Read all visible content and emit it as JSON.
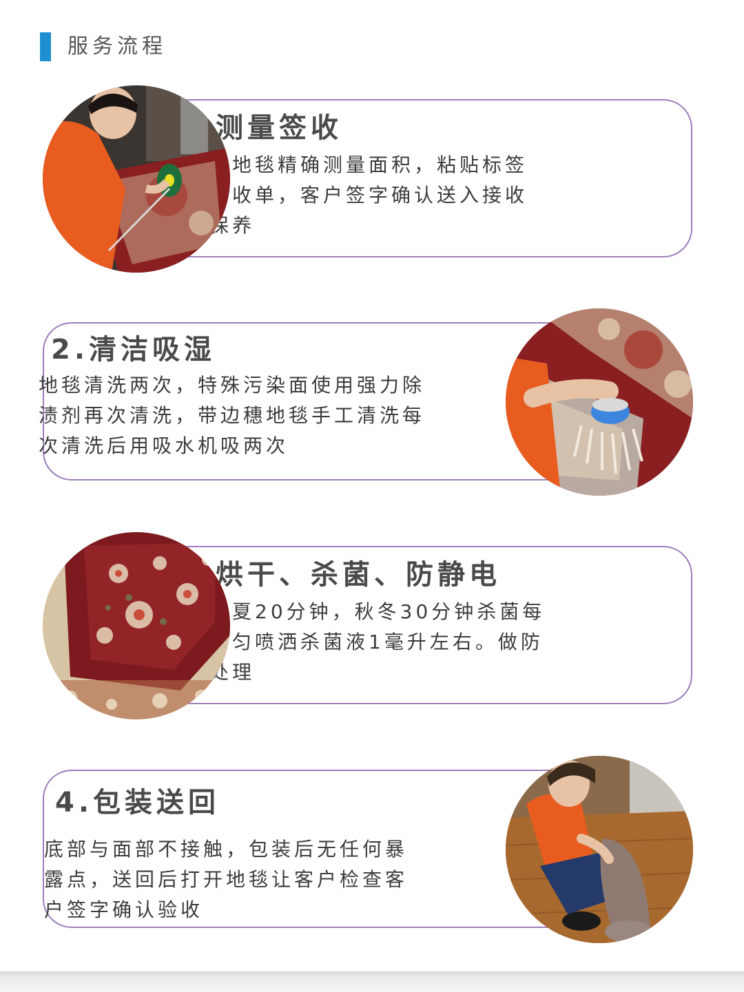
{
  "header": {
    "title": "服务流程",
    "accent_color": "#1e8fd0"
  },
  "card_border_color": "#9b7dbb",
  "steps": [
    {
      "title": "1.测量签收",
      "desc_lines": [
        "小面积地毯精确测量面积，粘贴标签",
        "开据接收单，客户签字确认送入接收",
        "间待保养"
      ],
      "photo_icon": "measuring-rug-photo"
    },
    {
      "title": "2.清洁吸湿",
      "desc_lines": [
        "地毯清洗两次，特殊污染面使用强力除",
        "渍剂再次清洗，带边穗地毯手工清洗每",
        "次清洗后用吸水机吸两次"
      ],
      "photo_icon": "brushing-fringe-photo"
    },
    {
      "title": "3.烘干、杀菌、防静电",
      "desc_lines": [
        "烘干春夏20分钟，秋冬30分钟杀菌每",
        "平米均匀喷洒杀菌液1毫升左右。做防",
        "静电处理"
      ],
      "photo_icon": "rug-pattern-photo"
    },
    {
      "title": "4.包装送回",
      "desc_lines": [
        "底部与面部不接触，包装后无任何暴",
        "露点，送回后打开地毯让客户检查客",
        "户签字确认验收"
      ],
      "photo_icon": "rolled-rug-photo"
    }
  ]
}
